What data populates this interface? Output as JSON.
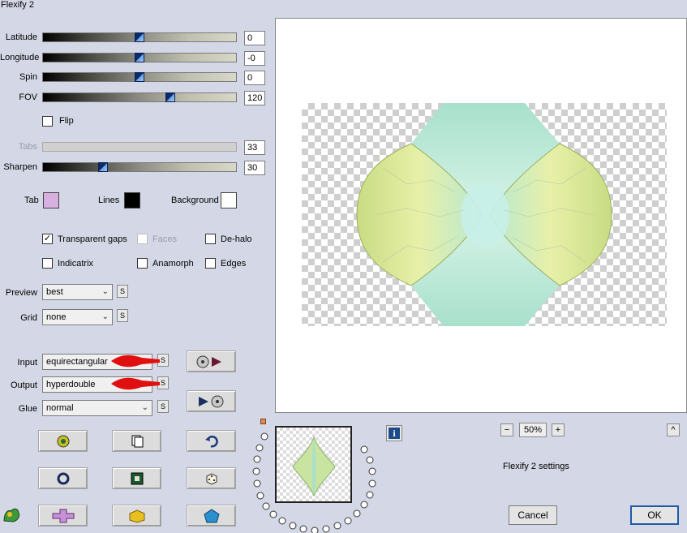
{
  "window": {
    "title": "Flexify 2"
  },
  "sliders": [
    {
      "label": "Latitude",
      "value": "0",
      "level": 0.5
    },
    {
      "label": "Longitude",
      "value": "-0",
      "level": 0.5
    },
    {
      "label": "Spin",
      "value": "0",
      "level": 0.5
    },
    {
      "label": "FOV",
      "value": "120",
      "level": 0.65
    }
  ],
  "flip": {
    "label": "Flip",
    "checked": false
  },
  "tabs": {
    "label": "Tabs",
    "value": "33",
    "enabled": false
  },
  "sharpen": {
    "label": "Sharpen",
    "value": "30",
    "level": 0.3
  },
  "colors": {
    "tab_label": "Tab",
    "tab_color": "#d8b0e0",
    "lines_label": "Lines",
    "lines_color": "#000000",
    "background_label": "Background",
    "background_color": "#ffffff"
  },
  "options": {
    "transparent_gaps": {
      "label": "Transparent gaps",
      "checked": true
    },
    "faces": {
      "label": "Faces",
      "checked": false,
      "enabled": false
    },
    "de_halo": {
      "label": "De-halo",
      "checked": false
    },
    "indicatrix": {
      "label": "Indicatrix",
      "checked": false
    },
    "anamorph": {
      "label": "Anamorph",
      "checked": false
    },
    "edges": {
      "label": "Edges",
      "checked": false
    }
  },
  "preview_select": {
    "label": "Preview",
    "value": "best"
  },
  "grid_select": {
    "label": "Grid",
    "value": "none"
  },
  "input_select": {
    "label": "Input",
    "value": "equirectangular"
  },
  "output_select": {
    "label": "Output",
    "value": "hyperdouble"
  },
  "glue_select": {
    "label": "Glue",
    "value": "normal"
  },
  "s_button": "S",
  "zoom": {
    "minus": "−",
    "value": "50%",
    "plus": "+",
    "up": "^"
  },
  "info_button": "i",
  "settings_label": "Flexify 2 settings",
  "cancel_label": "Cancel",
  "ok_label": "OK",
  "accent": "#1e5aa8",
  "annotation_arrow_color": "#e01010"
}
